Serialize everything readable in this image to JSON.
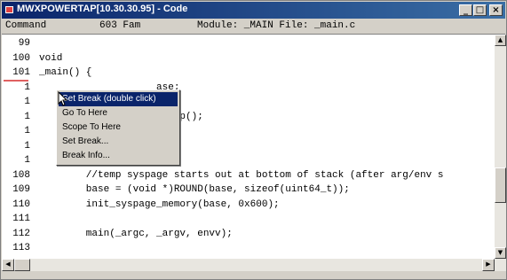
{
  "window": {
    "title": "MWXPOWERTAP[10.30.30.95] - Code",
    "buttons": {
      "minimize": "_",
      "maximize": "□",
      "close": "×"
    }
  },
  "status": {
    "mode": "Command",
    "page": "603 Fam",
    "module": "Module: _MAIN File: _main.c"
  },
  "code_lines": [
    {
      "num": "99",
      "text": ""
    },
    {
      "num": "100",
      "text": "void"
    },
    {
      "num": "101",
      "text": "_main() {"
    },
    {
      "num": "1",
      "text": "                    ase;"
    },
    {
      "num": "1",
      "text": ""
    },
    {
      "num": "1",
      "text": "                    setup();"
    },
    {
      "num": "1",
      "text": ""
    },
    {
      "num": "1",
      "text": "                    p();"
    },
    {
      "num": "1",
      "text": ""
    },
    {
      "num": "108",
      "text": "        //temp syspage starts out at bottom of stack (after arg/env s"
    },
    {
      "num": "109",
      "text": "        base = (void *)ROUND(base, sizeof(uint64_t));"
    },
    {
      "num": "110",
      "text": "        init_syspage_memory(base, 0x600);"
    },
    {
      "num": "111",
      "text": ""
    },
    {
      "num": "112",
      "text": "        main(_argc, _argv, envv);"
    },
    {
      "num": "113",
      "text": ""
    }
  ],
  "context_menu": [
    {
      "label": "Set Break (double click)",
      "selected": true
    },
    {
      "label": "Go To Here",
      "selected": false
    },
    {
      "label": "Scope To Here",
      "selected": false
    },
    {
      "label": "Set Break...",
      "selected": false
    },
    {
      "label": "Break Info...",
      "selected": false
    }
  ],
  "colors": {
    "titlebar_start": "#0a246a",
    "titlebar_end": "#3a6ea5",
    "menu_highlight": "#0a246a",
    "break_marker": "#e06060"
  },
  "icons": {
    "app": "app-icon",
    "scroll_up": "arrow-up-icon",
    "scroll_down": "arrow-down-icon",
    "scroll_left": "arrow-left-icon",
    "scroll_right": "arrow-right-icon",
    "cursor": "mouse-pointer-icon"
  }
}
